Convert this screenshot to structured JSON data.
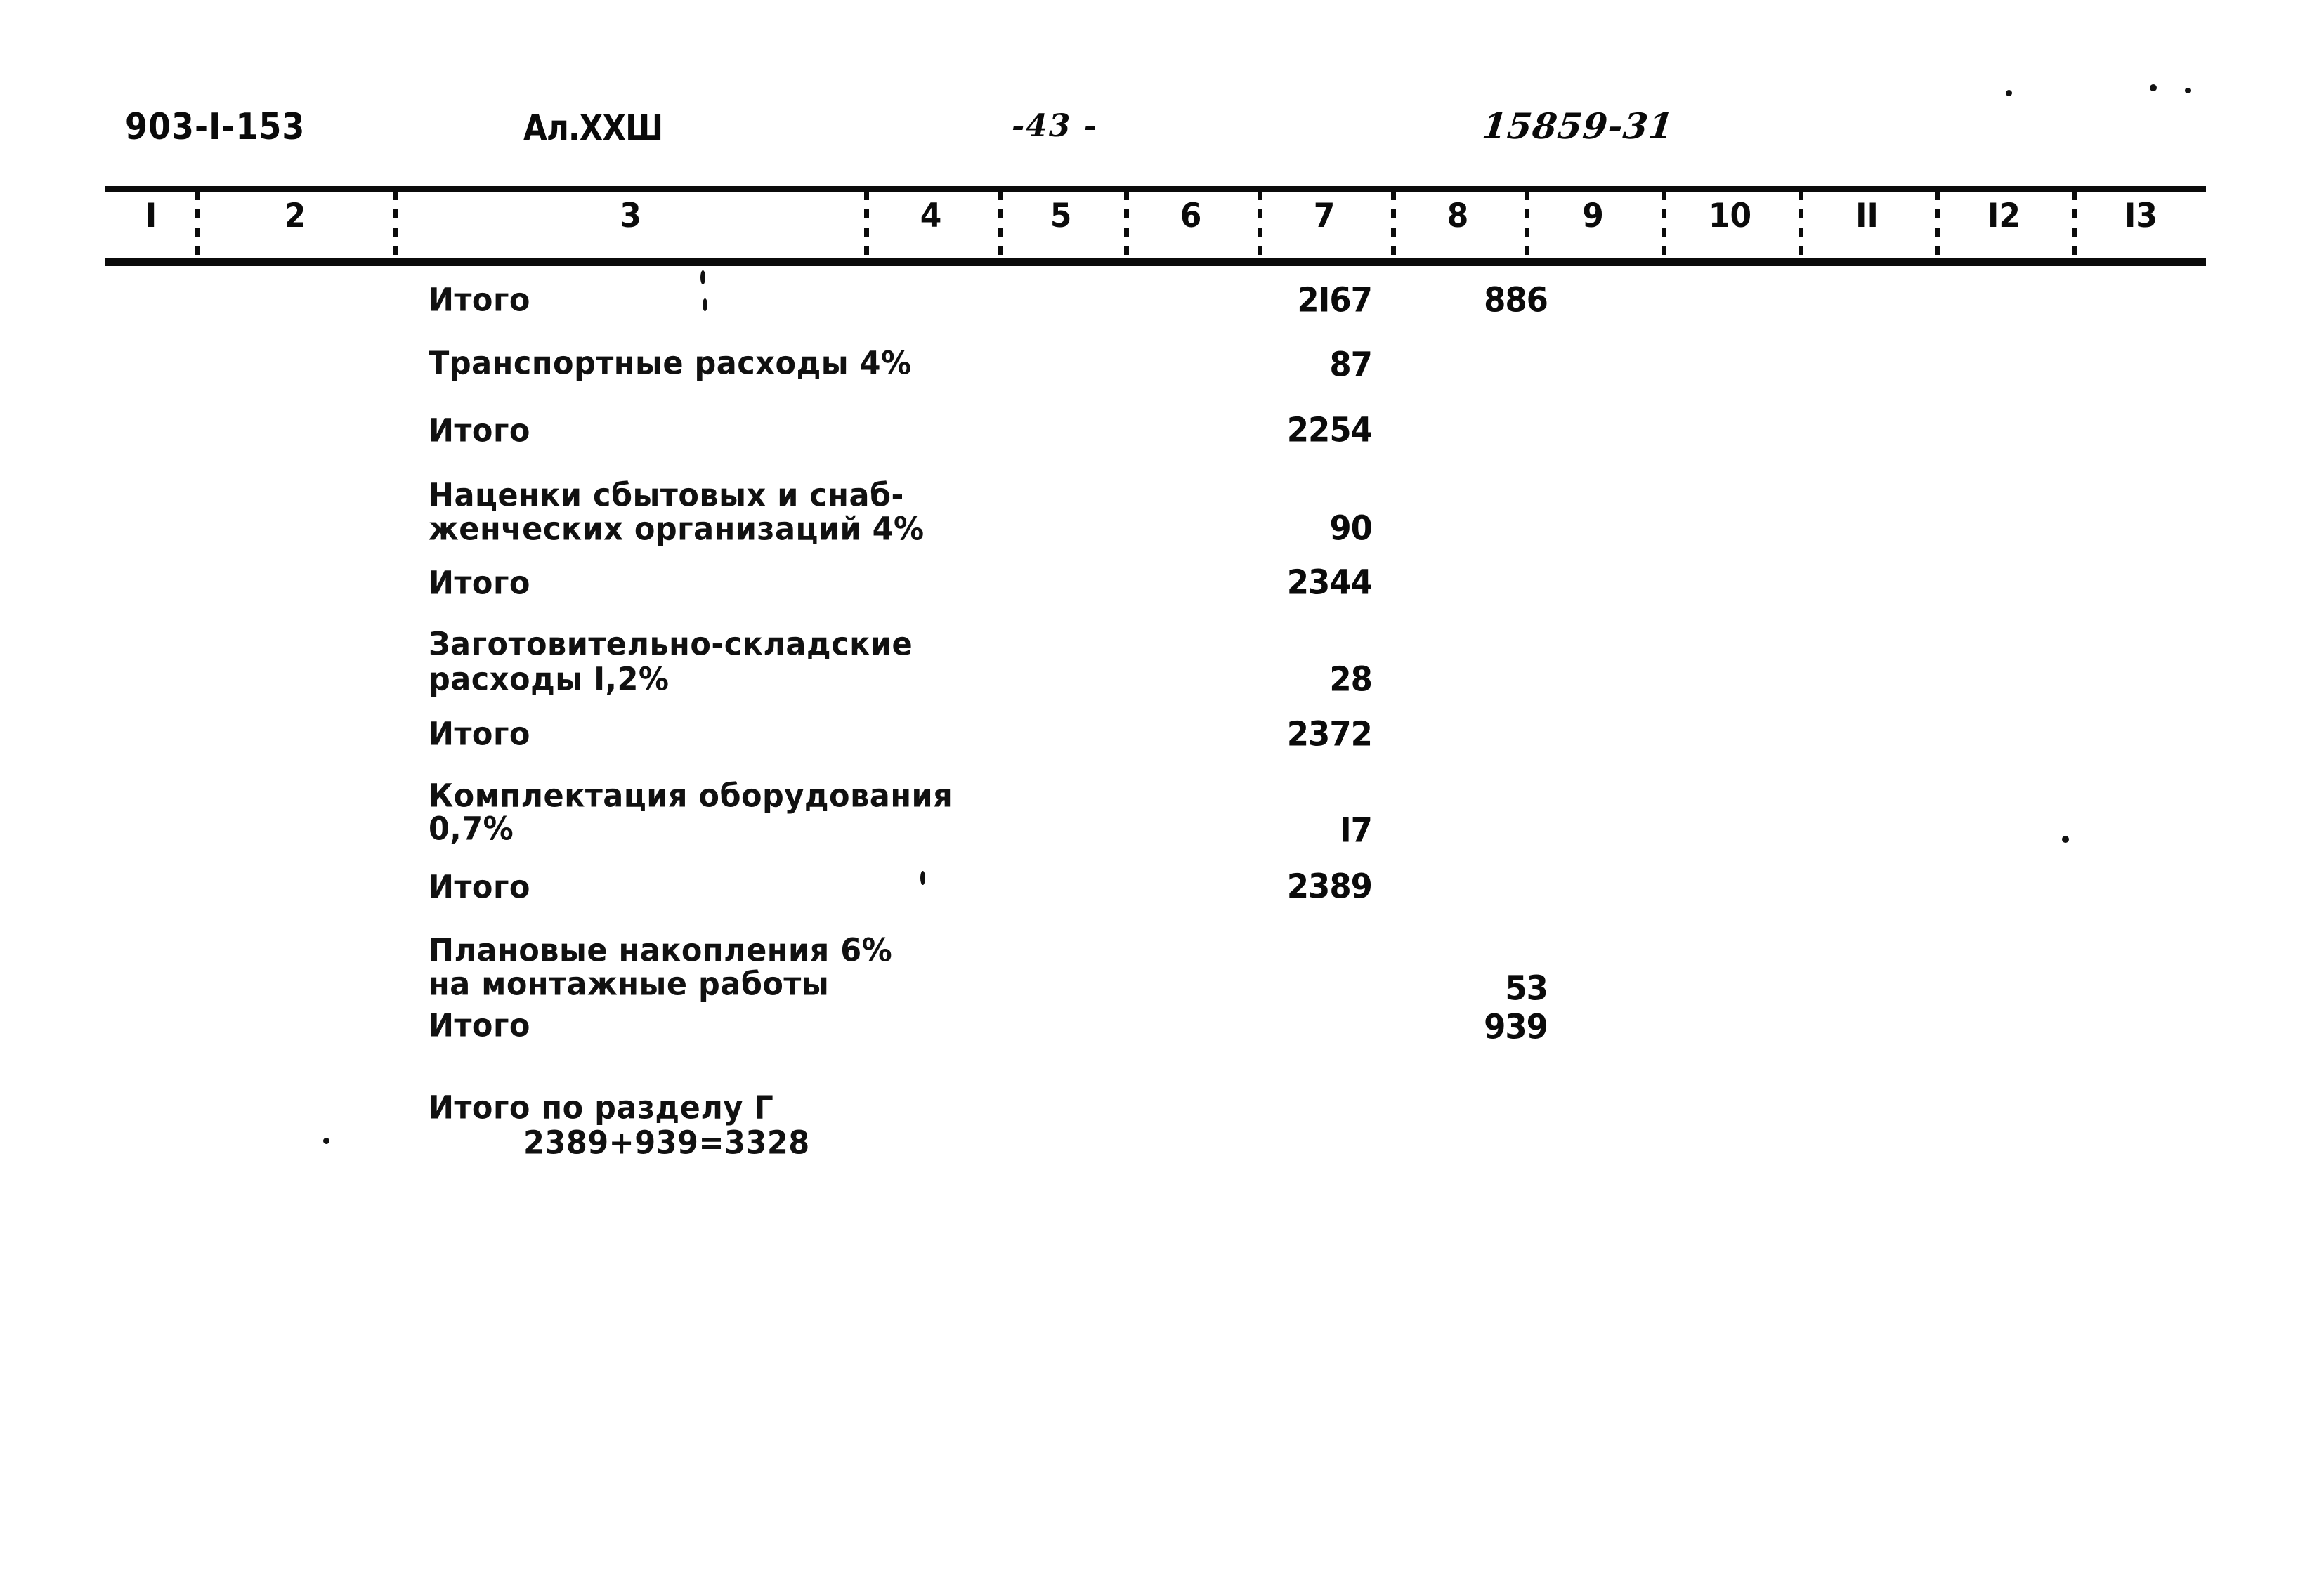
{
  "document": {
    "project_code": "903-I-153",
    "album": "Ал.XXШ",
    "page_number": "-43 -",
    "reference_number": "15859-31"
  },
  "table": {
    "column_headers": [
      "I",
      "2",
      "3",
      "4",
      "5",
      "6",
      "7",
      "8",
      "9",
      "10",
      "II",
      "I2",
      "I3"
    ],
    "rows": [
      {
        "label": "Итого",
        "label2": "",
        "col11": "2I67",
        "col12": "886"
      },
      {
        "label": "Транспортные расходы 4%",
        "label2": "",
        "col11": "87",
        "col12": ""
      },
      {
        "label": "Итого",
        "label2": "",
        "col11": "2254",
        "col12": ""
      },
      {
        "label": "Наценки сбытовых и снаб-",
        "label2": "женческих организаций 4%",
        "col11": "90",
        "col12": ""
      },
      {
        "label": "Итого",
        "label2": "",
        "col11": "2344",
        "col12": ""
      },
      {
        "label": "Заготовительно-складские",
        "label2": "расходы I,2%",
        "col11": "28",
        "col12": ""
      },
      {
        "label": "Итого",
        "label2": "",
        "col11": "2372",
        "col12": ""
      },
      {
        "label": "Комплектация оборудования",
        "label2": "0,7%",
        "col11": "I7",
        "col12": ""
      },
      {
        "label": "Итого",
        "label2": "",
        "col11": "2389",
        "col12": ""
      },
      {
        "label": "Плановые накопления 6%",
        "label2": "на монтажные работы",
        "col11": "",
        "col12": "53"
      },
      {
        "label": "Итого",
        "label2": "",
        "col11": "",
        "col12": "939"
      }
    ],
    "section_total": {
      "label": "Итого по разделу Г",
      "formula": "2389+939=3328"
    }
  }
}
